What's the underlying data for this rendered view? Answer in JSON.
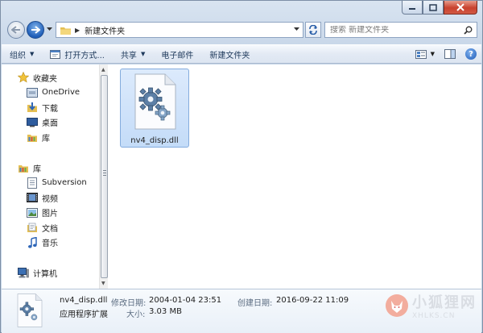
{
  "address": {
    "path": "新建文件夹",
    "search_placeholder": "搜索 新建文件夹"
  },
  "toolbar": {
    "organize": "组织",
    "open_with": "打开方式...",
    "share": "共享",
    "email": "电子邮件",
    "new_folder": "新建文件夹"
  },
  "nav": {
    "favorites": {
      "label": "收藏夹",
      "items": [
        "OneDrive",
        "下载",
        "桌面",
        "库"
      ]
    },
    "libraries": {
      "label": "库",
      "items": [
        "Subversion",
        "视频",
        "图片",
        "文档",
        "音乐"
      ]
    },
    "computer": "计算机"
  },
  "file": {
    "name": "nv4_disp.dll"
  },
  "details": {
    "name": "nv4_disp.dll",
    "type": "应用程序扩展",
    "modified_label": "修改日期:",
    "modified_value": "2004-01-04 23:51",
    "created_label": "创建日期:",
    "created_value": "2016-09-22 11:09",
    "size_label": "大小:",
    "size_value": "3.03 MB"
  },
  "watermark": {
    "cn": "小狐狸网",
    "en": "XHLKS.CN"
  },
  "colors": {
    "selection": "#c4dcf8",
    "accent": "#1d5bb8"
  }
}
